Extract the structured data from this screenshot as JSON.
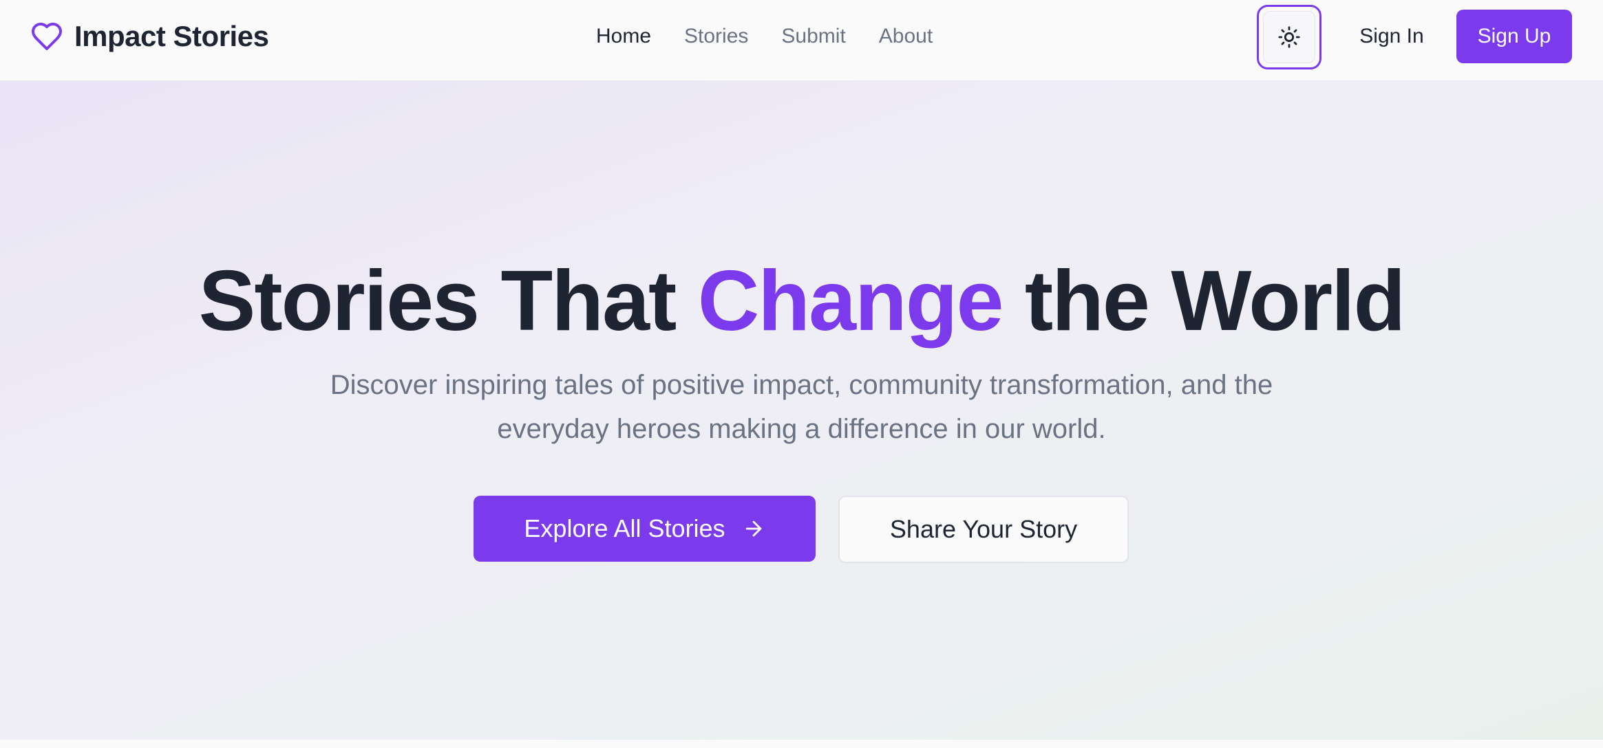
{
  "header": {
    "brand_name": "Impact Stories",
    "brand_icon": "heart-icon",
    "nav": [
      {
        "label": "Home",
        "active": true
      },
      {
        "label": "Stories",
        "active": false
      },
      {
        "label": "Submit",
        "active": false
      },
      {
        "label": "About",
        "active": false
      }
    ],
    "theme_toggle_icon": "sun-icon",
    "sign_in_label": "Sign In",
    "sign_up_label": "Sign Up"
  },
  "hero": {
    "title_part1": "Stories That ",
    "title_accent": "Change",
    "title_part2": " the World",
    "subtitle_line1": "Discover inspiring tales of positive impact, community transformation, and the",
    "subtitle_line2": "everyday heroes making a difference in our world.",
    "primary_button_label": "Explore All Stories",
    "primary_button_icon": "arrow-right-icon",
    "secondary_button_label": "Share Your Story"
  },
  "colors": {
    "accent": "#7c3aed",
    "text_dark": "#1e2432",
    "text_muted": "#6a7283"
  }
}
